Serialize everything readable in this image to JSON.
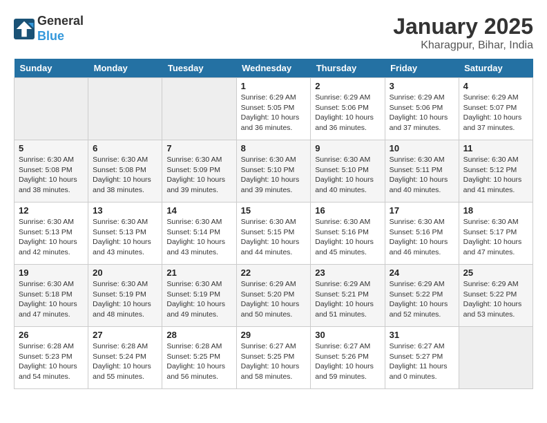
{
  "header": {
    "logo_line1": "General",
    "logo_line2": "Blue",
    "title": "January 2025",
    "subtitle": "Kharagpur, Bihar, India"
  },
  "weekdays": [
    "Sunday",
    "Monday",
    "Tuesday",
    "Wednesday",
    "Thursday",
    "Friday",
    "Saturday"
  ],
  "weeks": [
    [
      {
        "day": "",
        "info": ""
      },
      {
        "day": "",
        "info": ""
      },
      {
        "day": "",
        "info": ""
      },
      {
        "day": "1",
        "info": "Sunrise: 6:29 AM\nSunset: 5:05 PM\nDaylight: 10 hours\nand 36 minutes."
      },
      {
        "day": "2",
        "info": "Sunrise: 6:29 AM\nSunset: 5:06 PM\nDaylight: 10 hours\nand 36 minutes."
      },
      {
        "day": "3",
        "info": "Sunrise: 6:29 AM\nSunset: 5:06 PM\nDaylight: 10 hours\nand 37 minutes."
      },
      {
        "day": "4",
        "info": "Sunrise: 6:29 AM\nSunset: 5:07 PM\nDaylight: 10 hours\nand 37 minutes."
      }
    ],
    [
      {
        "day": "5",
        "info": "Sunrise: 6:30 AM\nSunset: 5:08 PM\nDaylight: 10 hours\nand 38 minutes."
      },
      {
        "day": "6",
        "info": "Sunrise: 6:30 AM\nSunset: 5:08 PM\nDaylight: 10 hours\nand 38 minutes."
      },
      {
        "day": "7",
        "info": "Sunrise: 6:30 AM\nSunset: 5:09 PM\nDaylight: 10 hours\nand 39 minutes."
      },
      {
        "day": "8",
        "info": "Sunrise: 6:30 AM\nSunset: 5:10 PM\nDaylight: 10 hours\nand 39 minutes."
      },
      {
        "day": "9",
        "info": "Sunrise: 6:30 AM\nSunset: 5:10 PM\nDaylight: 10 hours\nand 40 minutes."
      },
      {
        "day": "10",
        "info": "Sunrise: 6:30 AM\nSunset: 5:11 PM\nDaylight: 10 hours\nand 40 minutes."
      },
      {
        "day": "11",
        "info": "Sunrise: 6:30 AM\nSunset: 5:12 PM\nDaylight: 10 hours\nand 41 minutes."
      }
    ],
    [
      {
        "day": "12",
        "info": "Sunrise: 6:30 AM\nSunset: 5:13 PM\nDaylight: 10 hours\nand 42 minutes."
      },
      {
        "day": "13",
        "info": "Sunrise: 6:30 AM\nSunset: 5:13 PM\nDaylight: 10 hours\nand 43 minutes."
      },
      {
        "day": "14",
        "info": "Sunrise: 6:30 AM\nSunset: 5:14 PM\nDaylight: 10 hours\nand 43 minutes."
      },
      {
        "day": "15",
        "info": "Sunrise: 6:30 AM\nSunset: 5:15 PM\nDaylight: 10 hours\nand 44 minutes."
      },
      {
        "day": "16",
        "info": "Sunrise: 6:30 AM\nSunset: 5:16 PM\nDaylight: 10 hours\nand 45 minutes."
      },
      {
        "day": "17",
        "info": "Sunrise: 6:30 AM\nSunset: 5:16 PM\nDaylight: 10 hours\nand 46 minutes."
      },
      {
        "day": "18",
        "info": "Sunrise: 6:30 AM\nSunset: 5:17 PM\nDaylight: 10 hours\nand 47 minutes."
      }
    ],
    [
      {
        "day": "19",
        "info": "Sunrise: 6:30 AM\nSunset: 5:18 PM\nDaylight: 10 hours\nand 47 minutes."
      },
      {
        "day": "20",
        "info": "Sunrise: 6:30 AM\nSunset: 5:19 PM\nDaylight: 10 hours\nand 48 minutes."
      },
      {
        "day": "21",
        "info": "Sunrise: 6:30 AM\nSunset: 5:19 PM\nDaylight: 10 hours\nand 49 minutes."
      },
      {
        "day": "22",
        "info": "Sunrise: 6:29 AM\nSunset: 5:20 PM\nDaylight: 10 hours\nand 50 minutes."
      },
      {
        "day": "23",
        "info": "Sunrise: 6:29 AM\nSunset: 5:21 PM\nDaylight: 10 hours\nand 51 minutes."
      },
      {
        "day": "24",
        "info": "Sunrise: 6:29 AM\nSunset: 5:22 PM\nDaylight: 10 hours\nand 52 minutes."
      },
      {
        "day": "25",
        "info": "Sunrise: 6:29 AM\nSunset: 5:22 PM\nDaylight: 10 hours\nand 53 minutes."
      }
    ],
    [
      {
        "day": "26",
        "info": "Sunrise: 6:28 AM\nSunset: 5:23 PM\nDaylight: 10 hours\nand 54 minutes."
      },
      {
        "day": "27",
        "info": "Sunrise: 6:28 AM\nSunset: 5:24 PM\nDaylight: 10 hours\nand 55 minutes."
      },
      {
        "day": "28",
        "info": "Sunrise: 6:28 AM\nSunset: 5:25 PM\nDaylight: 10 hours\nand 56 minutes."
      },
      {
        "day": "29",
        "info": "Sunrise: 6:27 AM\nSunset: 5:25 PM\nDaylight: 10 hours\nand 58 minutes."
      },
      {
        "day": "30",
        "info": "Sunrise: 6:27 AM\nSunset: 5:26 PM\nDaylight: 10 hours\nand 59 minutes."
      },
      {
        "day": "31",
        "info": "Sunrise: 6:27 AM\nSunset: 5:27 PM\nDaylight: 11 hours\nand 0 minutes."
      },
      {
        "day": "",
        "info": ""
      }
    ]
  ]
}
